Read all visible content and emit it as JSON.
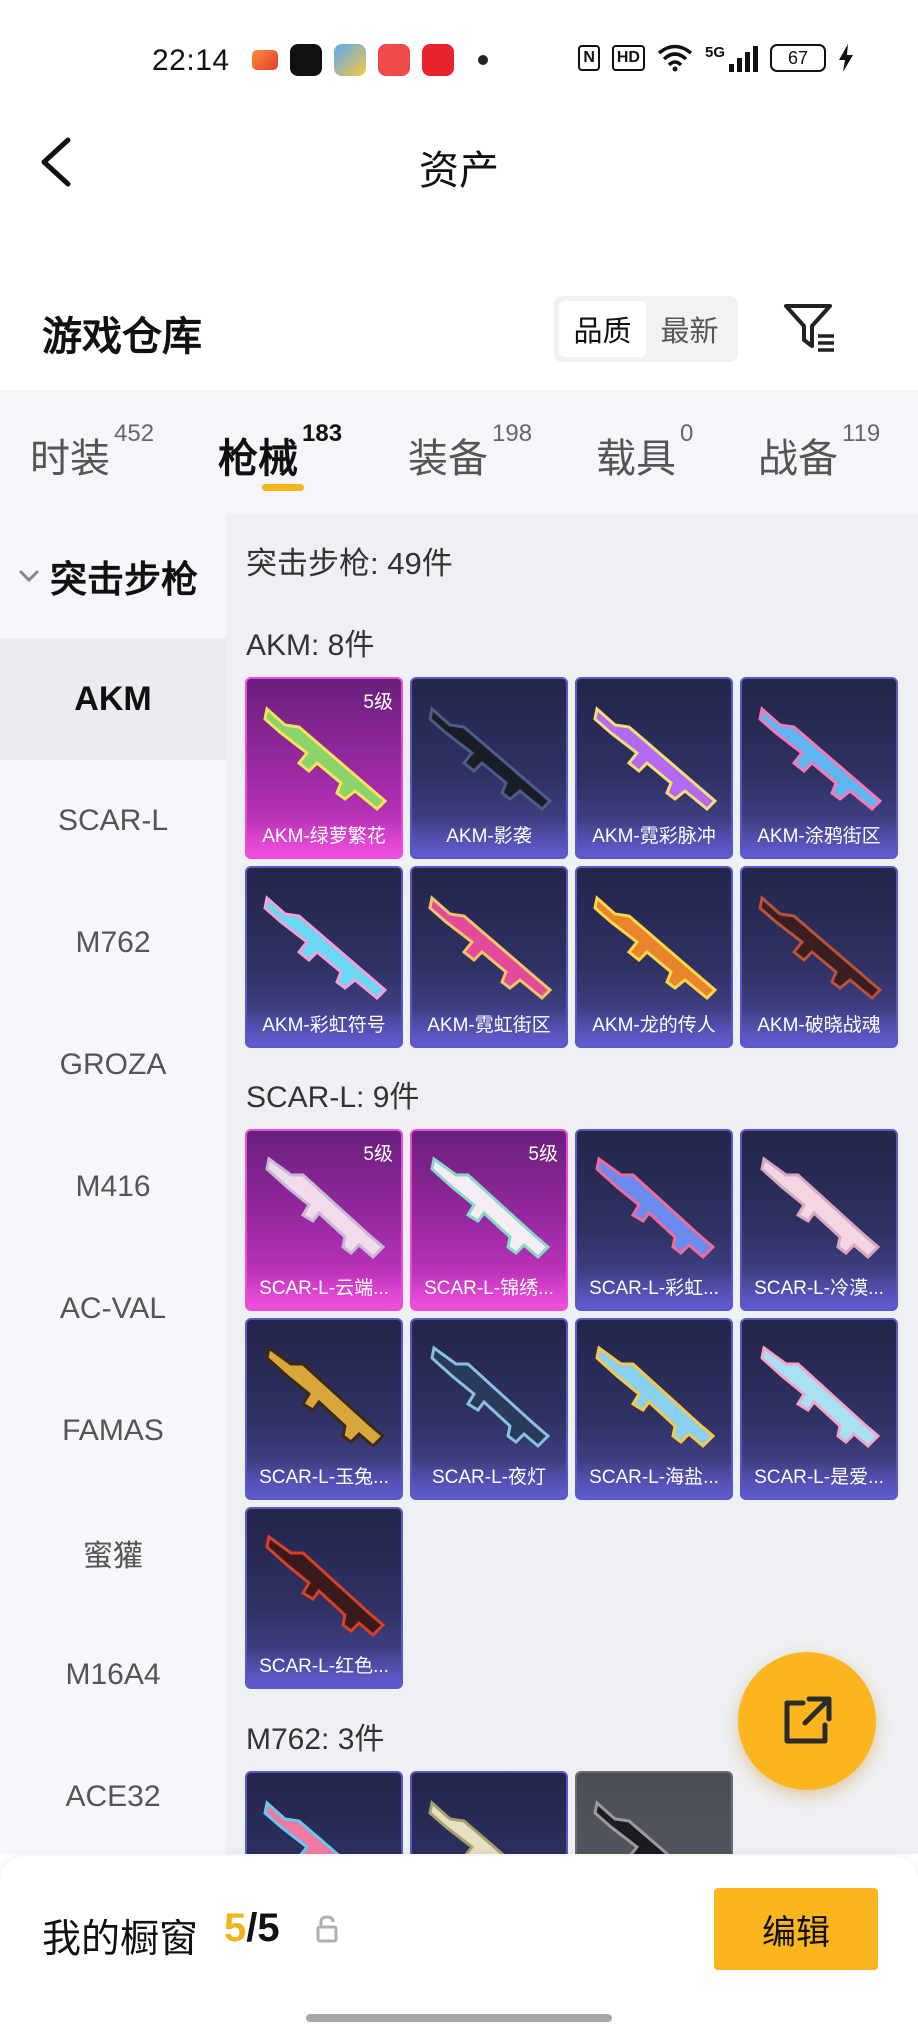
{
  "status": {
    "time": "22:14",
    "battery": "67",
    "network": "5G",
    "hd": "HD",
    "nfc": "N"
  },
  "header": {
    "title": "资产"
  },
  "warehouse": {
    "title": "游戏仓库",
    "sort_options": [
      "品质",
      "最新"
    ]
  },
  "tabs": [
    {
      "label": "时装",
      "count": "452"
    },
    {
      "label": "枪械",
      "count": "183"
    },
    {
      "label": "装备",
      "count": "198"
    },
    {
      "label": "载具",
      "count": "0"
    },
    {
      "label": "战备",
      "count": "119"
    }
  ],
  "sidebar": {
    "group": "突击步枪",
    "items": [
      "AKM",
      "SCAR-L",
      "M762",
      "GROZA",
      "M416",
      "AC-VAL",
      "FAMAS",
      "蜜獾",
      "M16A4",
      "ACE32"
    ]
  },
  "content": {
    "summary": "突击步枪: 49件",
    "sections": [
      {
        "title": "AKM: 8件",
        "cards": [
          {
            "name": "AKM-绿萝繁花",
            "level": "5级",
            "color": "#9d2aa5"
          },
          {
            "name": "AKM-影袭",
            "level": "",
            "color": "#2f3163"
          },
          {
            "name": "AKM-霓彩脉冲",
            "level": "",
            "color": "#2f3163"
          },
          {
            "name": "AKM-涂鸦街区",
            "level": "",
            "color": "#2f3163"
          },
          {
            "name": "AKM-彩虹符号",
            "level": "",
            "color": "#2f3163"
          },
          {
            "name": "AKM-霓虹街区",
            "level": "",
            "color": "#2f3163"
          },
          {
            "name": "AKM-龙的传人",
            "level": "",
            "color": "#2f3163"
          },
          {
            "name": "AKM-破晓战魂",
            "level": "",
            "color": "#2f3163"
          }
        ]
      },
      {
        "title": "SCAR-L: 9件",
        "cards": [
          {
            "name": "SCAR-L-云端...",
            "level": "5级",
            "color": "#9d2aa5"
          },
          {
            "name": "SCAR-L-锦绣...",
            "level": "5级",
            "color": "#9d2aa5"
          },
          {
            "name": "SCAR-L-彩虹...",
            "level": "",
            "color": "#2f3163"
          },
          {
            "name": "SCAR-L-冷漠...",
            "level": "",
            "color": "#2f3163"
          },
          {
            "name": "SCAR-L-玉兔...",
            "level": "",
            "color": "#2f3163"
          },
          {
            "name": "SCAR-L-夜灯",
            "level": "",
            "color": "#2f3163"
          },
          {
            "name": "SCAR-L-海盐...",
            "level": "",
            "color": "#2f3163"
          },
          {
            "name": "SCAR-L-是爱...",
            "level": "",
            "color": "#2f3163"
          },
          {
            "name": "SCAR-L-红色...",
            "level": "",
            "color": "#2f3163"
          }
        ]
      },
      {
        "title": "M762: 3件",
        "cards": []
      }
    ]
  },
  "bottom": {
    "showcase_label": "我的橱窗",
    "showcase_current": "5",
    "showcase_sep": "/",
    "showcase_total": "5",
    "edit_label": "编辑"
  },
  "colors": {
    "accent": "#f2b51c",
    "fab": "#fbb51f",
    "card_blue": "#2f3163",
    "card_pink": "#9d2aa5"
  }
}
